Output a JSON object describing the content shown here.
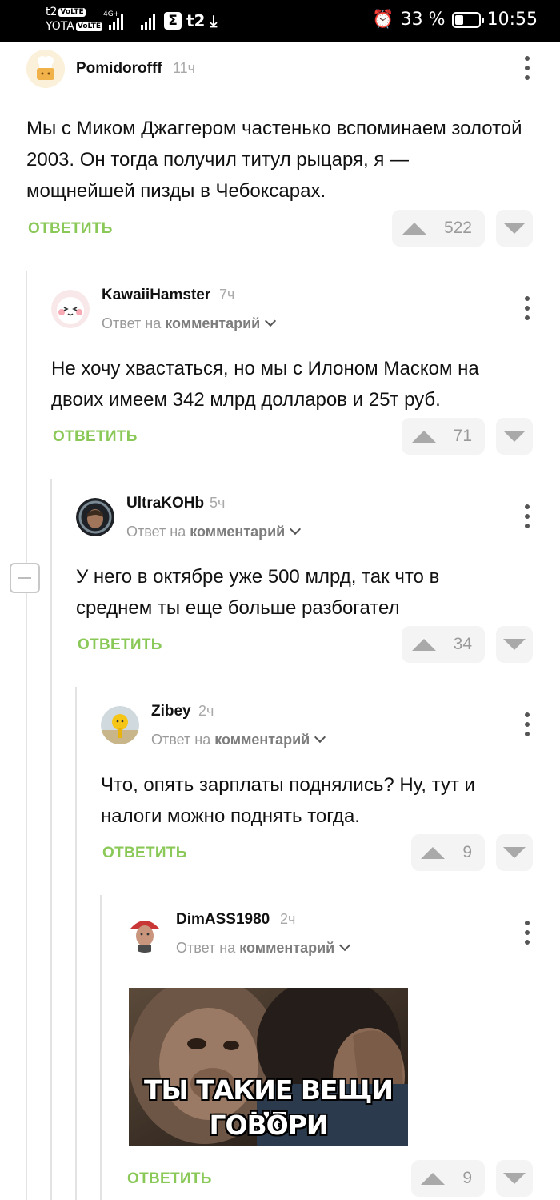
{
  "status_bar": {
    "carrier1": "t2",
    "carrier2": "YOTA",
    "volte": "VoLTE",
    "network": "4G+",
    "t2_logo": "t2",
    "battery_percent": "33 %",
    "time": "10:55",
    "icons": [
      "alarm-icon",
      "battery-icon",
      "download-icon",
      "sigma-icon"
    ]
  },
  "labels": {
    "reply": "ОТВЕТИТЬ",
    "reply_to_prefix": "Ответ на",
    "reply_to_target": "комментарий"
  },
  "comments": [
    {
      "author": "Pomidorofff",
      "time": "11ч",
      "text": "Мы с Миком Джаггером частенько вспоминаем золотой 2003. Он тогда получил титул рыцаря, я — мощнейшей пизды в Чебоксарах.",
      "rating": "522"
    },
    {
      "author": "KawaiiHamster",
      "time": "7ч",
      "text": "Не хочу хвастаться, но мы с Илоном Маском на двоих имеем 342 млрд долларов и 25т руб.",
      "rating": "71"
    },
    {
      "author": "UltraKOHb",
      "time": "5ч",
      "text": "У него в октябре уже 500 млрд, так что в среднем ты еще больше разбогател",
      "rating": "34"
    },
    {
      "author": "Zibey",
      "time": "2ч",
      "text": "Что, опять зарплаты поднялись? Ну, тут и налоги можно поднять тогда.",
      "rating": "9"
    },
    {
      "author": "DimASS1980",
      "time": "2ч",
      "image_caption_line1": "ТЫ ТАКИЕ ВЕЩИ НЕ",
      "image_caption_line2": "ГОВОРИ",
      "rating": "9"
    }
  ]
}
